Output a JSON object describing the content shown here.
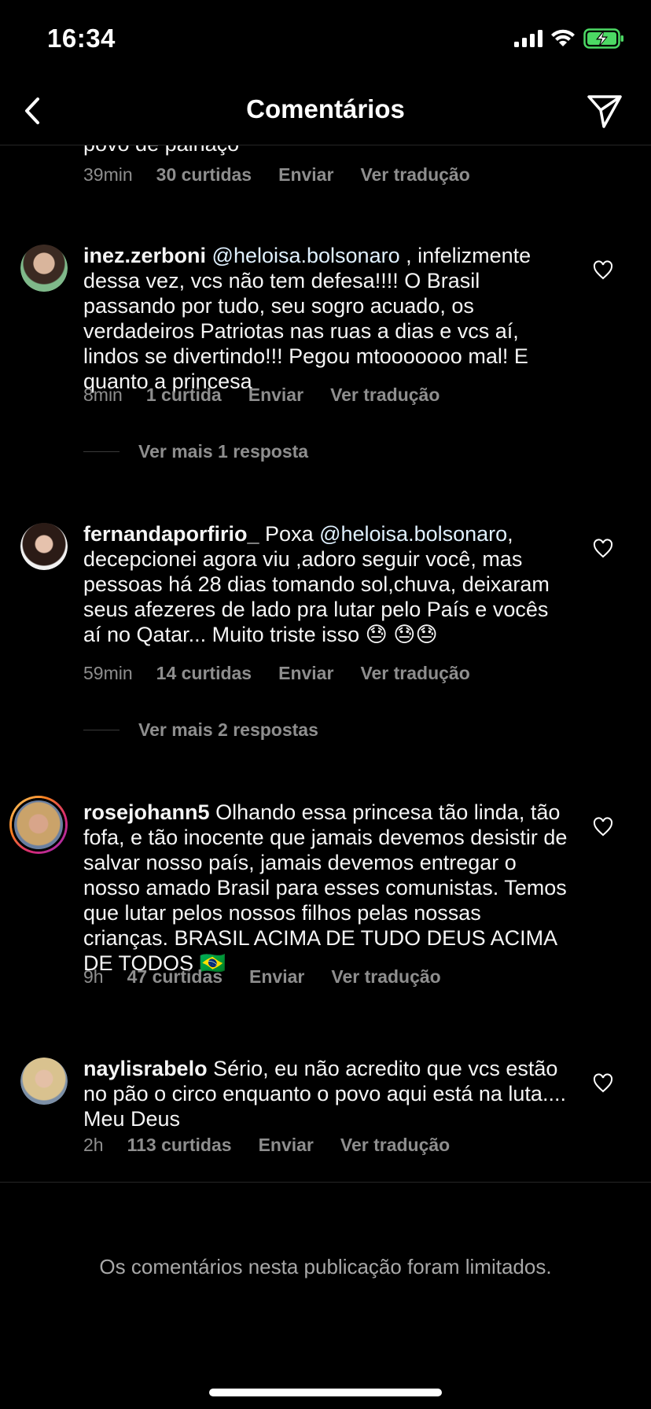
{
  "status": {
    "time": "16:34"
  },
  "nav": {
    "title": "Comentários"
  },
  "comments": [
    {
      "text": "povo de palhaço",
      "time": "39min",
      "likes": "30 curtidas",
      "reply": "Enviar",
      "translate": "Ver tradução"
    },
    {
      "user": "inez.zerboni",
      "mention": "@heloisa.bolsonaro",
      "text": " , infelizmente dessa vez, vcs não tem defesa!!!! O Brasil passando por tudo, seu sogro acuado, os verdadeiros Patriotas nas ruas a dias e vcs aí, lindos se divertindo!!! Pegou mtooooooo mal! E quanto a princesa",
      "time": "8min",
      "likes": "1 curtida",
      "reply": "Enviar",
      "translate": "Ver tradução",
      "more_replies": "Ver mais 1 resposta"
    },
    {
      "user": "fernandaporfirio_",
      "pre": "Poxa ",
      "mention": "@heloisa.bolsonaro",
      "text": ", decepcionei agora viu ,adoro seguir você, mas pessoas há 28 dias tomando sol,chuva, deixaram seus afezeres de lado pra lutar pelo País e vocês aí no Qatar... Muito triste isso 😓 😓😓",
      "time": "59min",
      "likes": "14 curtidas",
      "reply": "Enviar",
      "translate": "Ver tradução",
      "more_replies": "Ver mais 2 respostas"
    },
    {
      "user": "rosejohann5",
      "text": "Olhando essa princesa tão linda, tão fofa, e tão inocente que jamais devemos desistir de salvar nosso país, jamais devemos entregar o nosso amado Brasil para esses comunistas. Temos que lutar pelos nossos filhos pelas nossas crianças. BRASIL ACIMA DE TUDO DEUS ACIMA DE TODOS 🇧🇷",
      "time": "9h",
      "likes": "47 curtidas",
      "reply": "Enviar",
      "translate": "Ver tradução"
    },
    {
      "user": "naylisrabelo",
      "text": "Sério, eu não acredito que vcs estão no pão o circo enquanto o povo aqui está na luta.... Meu Deus",
      "time": "2h",
      "likes": "113 curtidas",
      "reply": "Enviar",
      "translate": "Ver tradução"
    }
  ],
  "footer": {
    "limited": "Os comentários nesta publicação foram limitados."
  },
  "colors": {
    "background": "#000000",
    "meta": "#8e8e8e",
    "battery": "#4cd964"
  },
  "icons": [
    "signal-icon",
    "wifi-icon",
    "battery-charging-icon",
    "back-icon",
    "send-icon",
    "heart-icon"
  ]
}
